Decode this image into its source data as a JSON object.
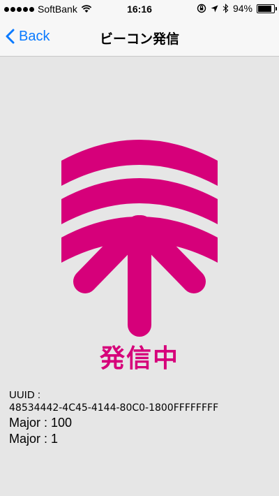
{
  "status_bar": {
    "carrier": "SoftBank",
    "time": "16:16",
    "battery_percent_text": "94%",
    "battery_level": 0.94,
    "icons": [
      "signal-dots-icon",
      "wifi-icon",
      "orientation-lock-icon",
      "location-arrow-icon",
      "bluetooth-icon",
      "battery-icon"
    ]
  },
  "nav": {
    "back_label": "Back",
    "title": "ビーコン発信"
  },
  "graphic": {
    "accent_color": "#d6007a",
    "icon": "beacon-broadcast-arrow-icon",
    "status_label": "発信中"
  },
  "beacon_info": {
    "uuid_label": "UUID :",
    "uuid_value": "48534442-4C45-4144-80C0-1800FFFFFFFF",
    "major_line_1": "Major : 100",
    "major_line_2": "Major : 1"
  },
  "colors": {
    "background": "#e6e6e6",
    "nav_background": "#f7f7f7",
    "link_blue": "#0a7aff"
  }
}
